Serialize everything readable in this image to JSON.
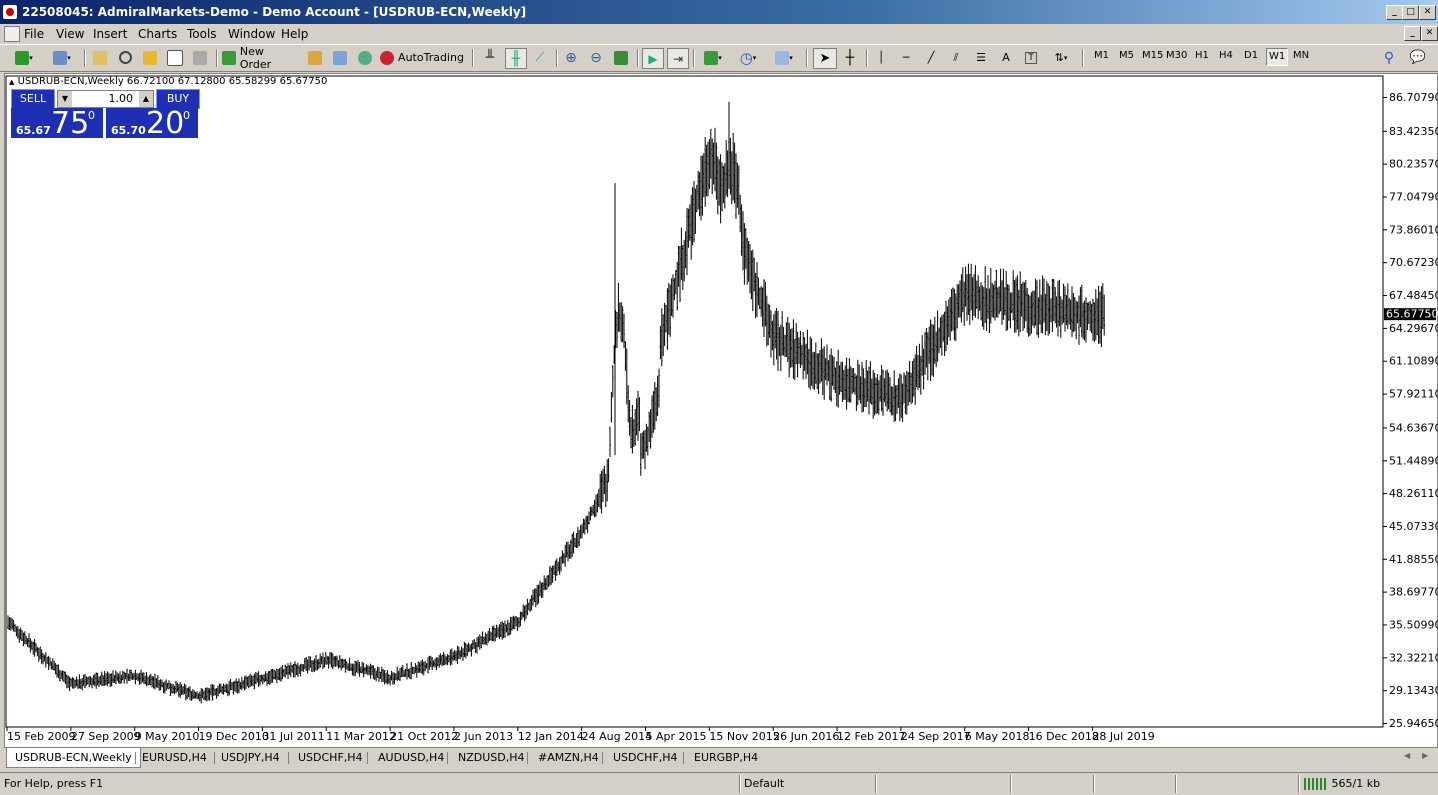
{
  "window": {
    "title": "22508045: AdmiralMarkets-Demo - Demo Account - [USDRUB-ECN,Weekly]"
  },
  "menu": [
    "File",
    "View",
    "Insert",
    "Charts",
    "Tools",
    "Window",
    "Help"
  ],
  "toolbar": {
    "new_order": "New Order",
    "autotrading": "AutoTrading",
    "timeframes": [
      "M1",
      "M5",
      "M15",
      "M30",
      "H1",
      "H4",
      "D1",
      "W1",
      "MN"
    ],
    "active_timeframe": "W1"
  },
  "chart": {
    "header": "USDRUB-ECN,Weekly  66.72100 67.12800 65.58299 65.67750",
    "one_click": {
      "sell_label": "SELL",
      "buy_label": "BUY",
      "lot": "1.00",
      "sell_small": "65.67",
      "sell_big": "75",
      "sell_sup": "0",
      "buy_small": "65.70",
      "buy_big": "20",
      "buy_sup": "0"
    }
  },
  "chart_data": {
    "type": "ohlc-bar",
    "symbol": "USDRUB-ECN",
    "timeframe": "Weekly",
    "y_ticks": [
      "86.70790",
      "83.42350",
      "80.23570",
      "77.04790",
      "73.86010",
      "70.67230",
      "67.48450",
      "64.29670",
      "61.10890",
      "57.92110",
      "54.63670",
      "51.44890",
      "48.26110",
      "45.07330",
      "41.88550",
      "38.69770",
      "35.50990",
      "32.32210",
      "29.13430",
      "25.94650"
    ],
    "ylim": [
      25.9465,
      86.7079
    ],
    "current_price": "65.67750",
    "x_ticks": [
      "15 Feb 2009",
      "27 Sep 2009",
      "9 May 2010",
      "19 Dec 2010",
      "31 Jul 2011",
      "11 Mar 2012",
      "21 Oct 2012",
      "2 Jun 2013",
      "12 Jan 2014",
      "24 Aug 2014",
      "5 Apr 2015",
      "15 Nov 2015",
      "26 Jun 2016",
      "12 Feb 2017",
      "24 Sep 2017",
      "6 May 2018",
      "16 Dec 2018",
      "28 Jul 2019"
    ],
    "trend_points": [
      [
        "15 Feb 2009",
        35.9
      ],
      [
        "27 Sep 2009",
        29.8
      ],
      [
        "9 May 2010",
        30.6
      ],
      [
        "19 Dec 2010",
        28.6
      ],
      [
        "31 Jul 2011",
        30.3
      ],
      [
        "11 Mar 2012",
        32.1
      ],
      [
        "21 Oct 2012",
        30.4
      ],
      [
        "2 Jun 2013",
        32.4
      ],
      [
        "12 Jan 2014",
        35.8
      ],
      [
        "24 Aug 2014",
        44.5
      ],
      [
        "5 Apr 2015",
        57.0
      ],
      [
        "15 Nov 2015",
        81.5
      ],
      [
        "26 Jun 2016",
        63.5
      ],
      [
        "12 Feb 2017",
        59.5
      ],
      [
        "24 Sep 2017",
        57.5
      ],
      [
        "6 May 2018",
        67.5
      ],
      [
        "16 Dec 2018",
        66.5
      ],
      [
        "28 Jul 2019",
        65.7
      ]
    ]
  },
  "tabs": [
    "USDRUB-ECN,Weekly",
    "EURUSD,H4",
    "USDJPY,H4",
    "USDCHF,H4",
    "AUDUSD,H4",
    "NZDUSD,H4",
    "#AMZN,H4",
    "USDCHF,H4",
    "EURGBP,H4"
  ],
  "status": {
    "help": "For Help, press F1",
    "profile": "Default",
    "traffic": "565/1 kb"
  }
}
